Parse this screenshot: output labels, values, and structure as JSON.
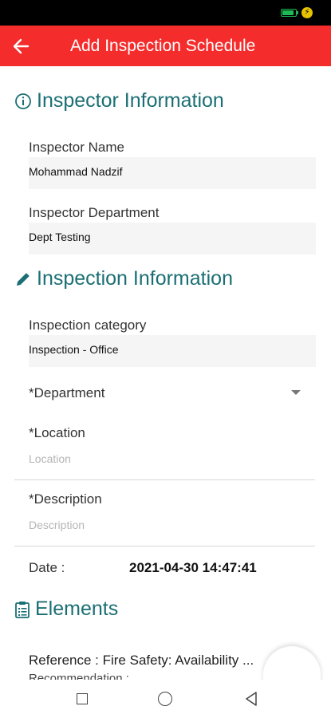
{
  "app_bar": {
    "title": "Add Inspection Schedule",
    "back_icon": "arrow-left-icon",
    "color": "#f42c2c"
  },
  "inspector_section": {
    "heading": "Inspector Information",
    "icon": "info-circle-icon",
    "name_label": "Inspector Name",
    "name_value": "Mohammad Nadzif",
    "department_label": "Inspector Department",
    "department_value": "Dept Testing"
  },
  "inspection_section": {
    "heading": "Inspection Information",
    "icon": "pencil-icon",
    "category_label": "Inspection category",
    "category_value": "Inspection - Office",
    "department_label": "*Department",
    "location_label": "*Location",
    "location_placeholder": "Location",
    "description_label": "*Description",
    "description_placeholder": "Description",
    "date_label": "Date :",
    "date_value": "2021-04-30 14:47:41"
  },
  "elements_section": {
    "heading": "Elements",
    "icon": "clipboard-list-icon",
    "reference_text": "Reference : Fire Safety: Availability ...",
    "recommendation_text": "Recommendation :"
  },
  "colors": {
    "heading": "#1b6f74",
    "accent": "#f42c2c"
  }
}
